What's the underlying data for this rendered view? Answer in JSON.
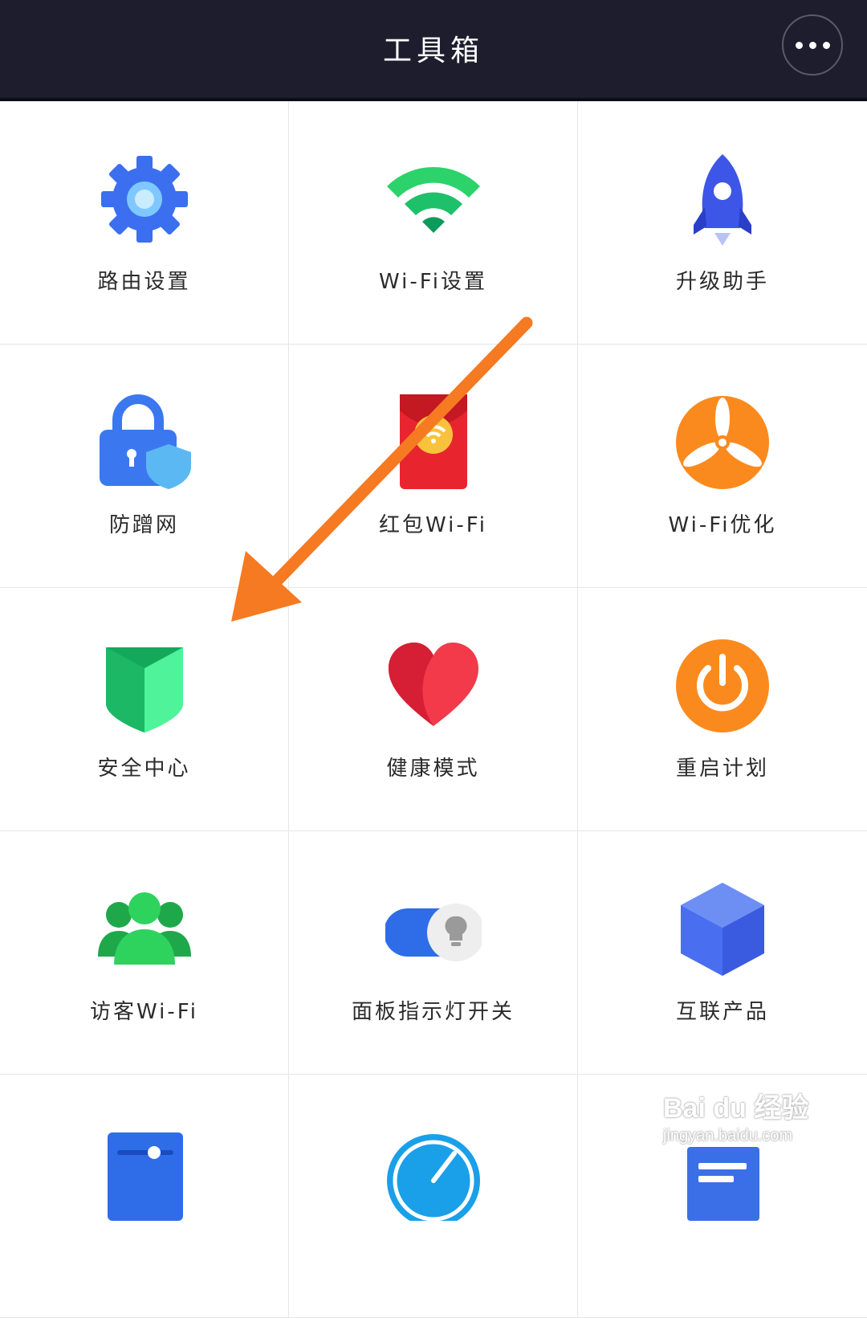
{
  "header": {
    "title": "工具箱",
    "more_icon": "ellipsis-icon"
  },
  "tools": [
    {
      "label": "路由设置",
      "icon": "gear-icon",
      "color": "#3b6ff0"
    },
    {
      "label": "Wi-Fi设置",
      "icon": "wifi-icon",
      "color": "#2bd36a"
    },
    {
      "label": "升级助手",
      "icon": "rocket-icon",
      "color": "#3d56e8"
    },
    {
      "label": "防蹭网",
      "icon": "lock-shield-icon",
      "color": "#3b78f0"
    },
    {
      "label": "红包Wi-Fi",
      "icon": "red-envelope-icon",
      "color": "#e8252f"
    },
    {
      "label": "Wi-Fi优化",
      "icon": "fan-icon",
      "color": "#fb8a1e"
    },
    {
      "label": "安全中心",
      "icon": "security-shield-icon",
      "color": "#21c56a"
    },
    {
      "label": "健康模式",
      "icon": "heart-icon",
      "color": "#f23a4a"
    },
    {
      "label": "重启计划",
      "icon": "power-icon",
      "color": "#fb8a1e"
    },
    {
      "label": "访客Wi-Fi",
      "icon": "guests-icon",
      "color": "#2bc55a"
    },
    {
      "label": "面板指示灯开关",
      "icon": "toggle-light-icon",
      "color": "#2f6de8"
    },
    {
      "label": "互联产品",
      "icon": "cube-icon",
      "color": "#4a6ef0"
    },
    {
      "label": "",
      "icon": "slider-panel-icon",
      "color": "#2f6de8"
    },
    {
      "label": "",
      "icon": "speedometer-icon",
      "color": "#1aa0e8"
    },
    {
      "label": "",
      "icon": "document-icon",
      "color": "#3a6fe8"
    }
  ],
  "annotation": {
    "arrow_icon": "arrow-annotation-icon",
    "color": "#f57a22"
  },
  "watermark": {
    "brand": "Bai du 经验",
    "url": "jingyan.baidu.com"
  }
}
